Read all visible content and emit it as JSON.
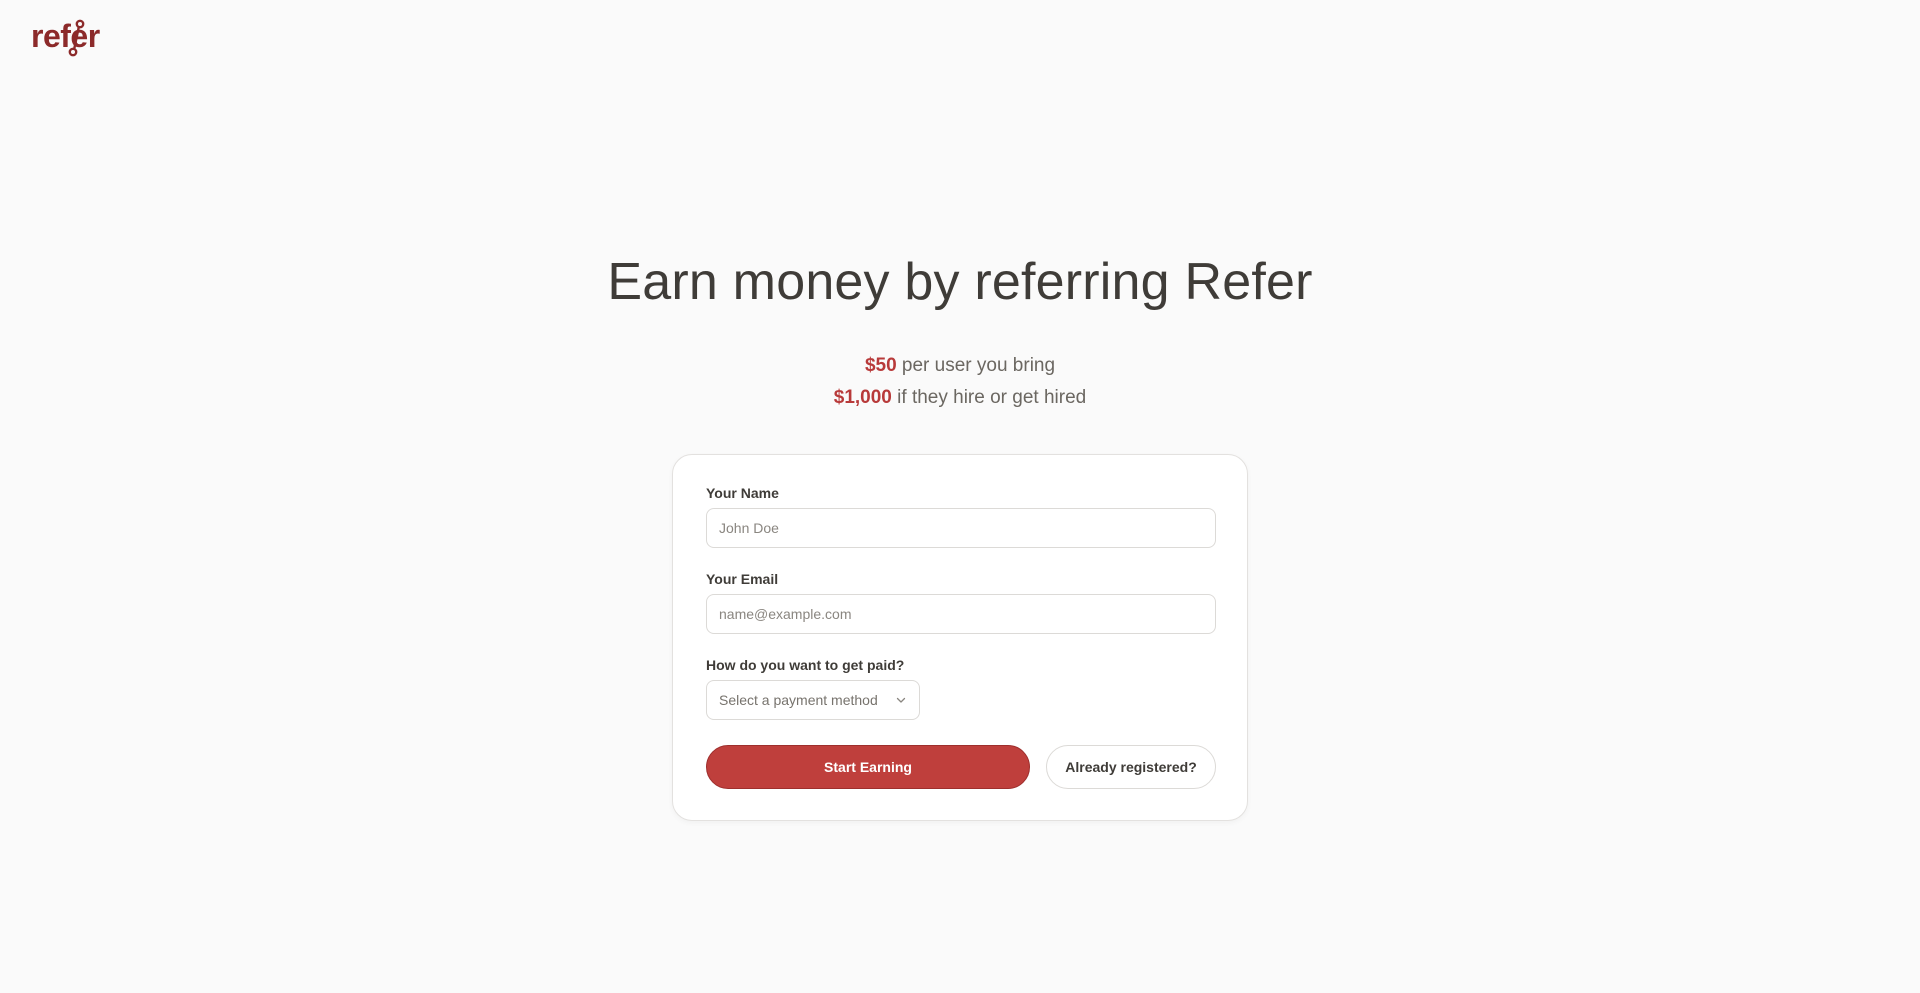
{
  "brand": {
    "logo_text": "refer",
    "logo_icon": "node-link-icon",
    "color": "#8c2a2a"
  },
  "hero": {
    "title": "Earn money by referring Refer",
    "benefits": [
      {
        "amount": "$50",
        "text": " per user you bring"
      },
      {
        "amount": "$1,000",
        "text": " if they hire or get hired"
      }
    ],
    "amount_color": "#b83a3a"
  },
  "form": {
    "name_label": "Your Name",
    "name_placeholder": "John Doe",
    "email_label": "Your Email",
    "email_placeholder": "name@example.com",
    "payment_label": "How do you want to get paid?",
    "payment_placeholder": "Select a payment method",
    "payment_icon": "chevron-down-icon",
    "submit_label": "Start Earning",
    "login_label": "Already registered?",
    "accent_color": "#bf3f3c"
  }
}
